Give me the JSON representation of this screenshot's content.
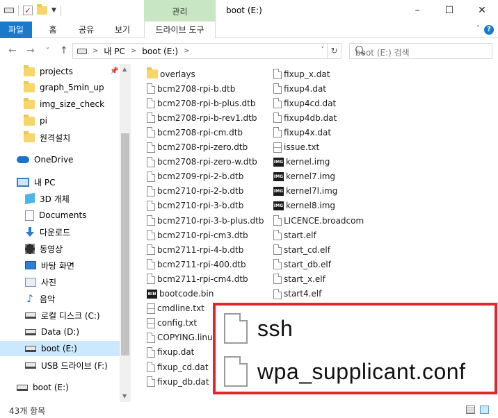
{
  "window": {
    "title": "boot (E:)",
    "context_tab_label": "관리",
    "minimize": "–",
    "maximize": "☐",
    "close": "✕"
  },
  "ribbon": {
    "tabs": [
      "파일",
      "홈",
      "공유",
      "보기",
      "드라이브 도구"
    ],
    "expand": "˅",
    "help": "?"
  },
  "address": {
    "back": "←",
    "forward": "→",
    "recent": "˅",
    "up": "↑",
    "crumbs": [
      "내 PC",
      "boot (E:)"
    ],
    "crumb_sep": ">",
    "dropdown": "˅",
    "refresh": "↻",
    "search_placeholder": "boot (E:) 검색"
  },
  "nav": {
    "items": [
      {
        "label": "projects",
        "icon": "folder-icon",
        "pinned": true
      },
      {
        "label": "graph_5min_up",
        "icon": "folder-icon"
      },
      {
        "label": "img_size_check",
        "icon": "folder-icon"
      },
      {
        "label": "pi",
        "icon": "folder-icon"
      },
      {
        "label": "원격설치",
        "icon": "folder-icon"
      },
      {
        "label": "OneDrive",
        "icon": "onedrive-icon"
      },
      {
        "label": "내 PC",
        "icon": "this-pc-icon"
      },
      {
        "label": "3D 개체",
        "icon": "3d-objects-icon"
      },
      {
        "label": "Documents",
        "icon": "documents-icon"
      },
      {
        "label": "다운로드",
        "icon": "downloads-icon"
      },
      {
        "label": "동영상",
        "icon": "videos-icon"
      },
      {
        "label": "바탕 화면",
        "icon": "desktop-icon"
      },
      {
        "label": "사진",
        "icon": "pictures-icon"
      },
      {
        "label": "음악",
        "icon": "music-icon"
      },
      {
        "label": "로컬 디스크 (C:)",
        "icon": "drive-icon"
      },
      {
        "label": "Data (D:)",
        "icon": "drive-icon"
      },
      {
        "label": "boot (E:)",
        "icon": "drive-icon",
        "selected": true
      },
      {
        "label": "USB 드라이브 (F:)",
        "icon": "usb-drive-icon"
      },
      {
        "label": "boot (E:)",
        "icon": "drive-icon"
      }
    ],
    "pin_glyph": "📌",
    "music_glyph": "♪"
  },
  "files": {
    "column1": [
      {
        "name": "overlays",
        "type": "folder"
      },
      {
        "name": "bcm2708-rpi-b.dtb",
        "type": "doc"
      },
      {
        "name": "bcm2708-rpi-b-plus.dtb",
        "type": "doc"
      },
      {
        "name": "bcm2708-rpi-b-rev1.dtb",
        "type": "doc"
      },
      {
        "name": "bcm2708-rpi-cm.dtb",
        "type": "doc"
      },
      {
        "name": "bcm2708-rpi-zero.dtb",
        "type": "doc"
      },
      {
        "name": "bcm2708-rpi-zero-w.dtb",
        "type": "doc"
      },
      {
        "name": "bcm2709-rpi-2-b.dtb",
        "type": "doc"
      },
      {
        "name": "bcm2710-rpi-2-b.dtb",
        "type": "doc"
      },
      {
        "name": "bcm2710-rpi-3-b.dtb",
        "type": "doc"
      },
      {
        "name": "bcm2710-rpi-3-b-plus.dtb",
        "type": "doc"
      },
      {
        "name": "bcm2710-rpi-cm3.dtb",
        "type": "doc"
      },
      {
        "name": "bcm2711-rpi-4-b.dtb",
        "type": "doc"
      },
      {
        "name": "bcm2711-rpi-400.dtb",
        "type": "doc"
      },
      {
        "name": "bcm2711-rpi-cm4.dtb",
        "type": "doc"
      },
      {
        "name": "bootcode.bin",
        "type": "bin"
      },
      {
        "name": "cmdline.txt",
        "type": "txt"
      },
      {
        "name": "config.txt",
        "type": "txt"
      },
      {
        "name": "COPYING.linux",
        "type": "doc"
      },
      {
        "name": "fixup.dat",
        "type": "doc"
      },
      {
        "name": "fixup_cd.dat",
        "type": "doc"
      },
      {
        "name": "fixup_db.dat",
        "type": "doc"
      }
    ],
    "column2": [
      {
        "name": "fixup_x.dat",
        "type": "doc"
      },
      {
        "name": "fixup4.dat",
        "type": "doc"
      },
      {
        "name": "fixup4cd.dat",
        "type": "doc"
      },
      {
        "name": "fixup4db.dat",
        "type": "doc"
      },
      {
        "name": "fixup4x.dat",
        "type": "doc"
      },
      {
        "name": "issue.txt",
        "type": "txt"
      },
      {
        "name": "kernel.img",
        "type": "img"
      },
      {
        "name": "kernel7.img",
        "type": "img"
      },
      {
        "name": "kernel7l.img",
        "type": "img"
      },
      {
        "name": "kernel8.img",
        "type": "img"
      },
      {
        "name": "LICENCE.broadcom",
        "type": "doc"
      },
      {
        "name": "start.elf",
        "type": "doc"
      },
      {
        "name": "start_cd.elf",
        "type": "doc"
      },
      {
        "name": "start_db.elf",
        "type": "doc"
      },
      {
        "name": "start_x.elf",
        "type": "doc"
      },
      {
        "name": "start4.elf",
        "type": "doc"
      }
    ],
    "img_badge": "IMG",
    "bin_badge": "BIN"
  },
  "highlight": {
    "items": [
      "ssh",
      "wpa_supplicant.conf"
    ],
    "border_color": "#e1262c"
  },
  "status": {
    "count": "43개 항목"
  },
  "colors": {
    "file_tab": "#1979ca",
    "context_tab": "#c8e6c4",
    "selection": "#cce8ff"
  }
}
